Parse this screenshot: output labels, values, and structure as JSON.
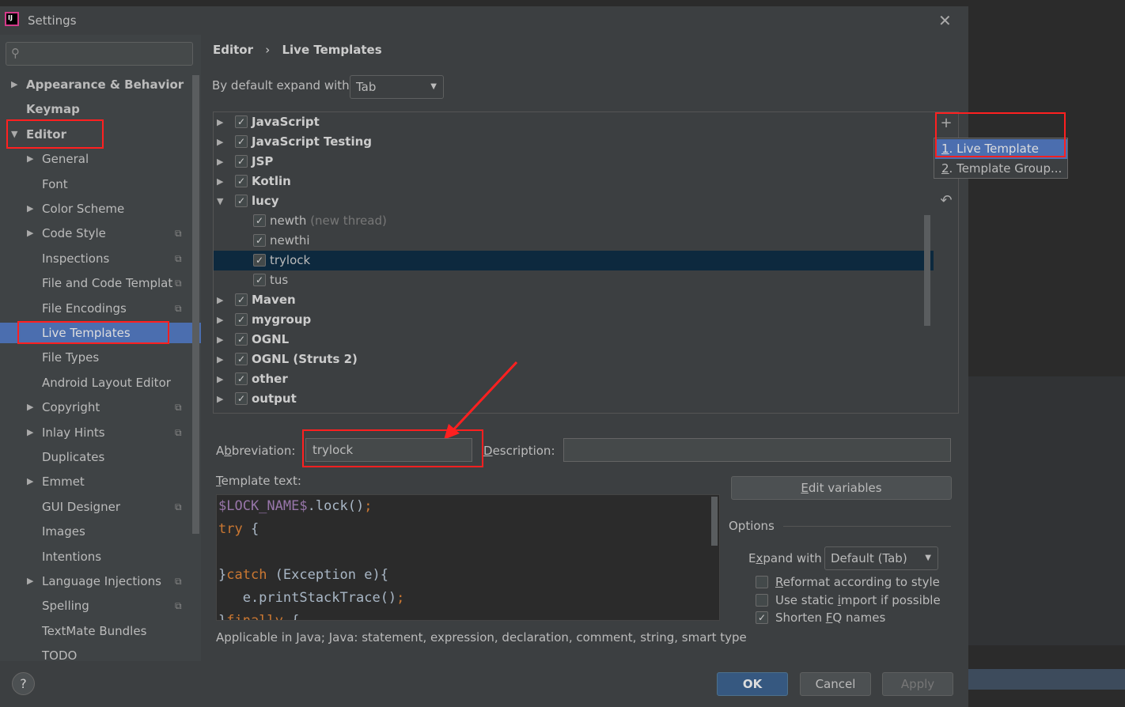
{
  "window": {
    "title": "Settings",
    "close": "✕",
    "app_icon": "IJ"
  },
  "search": {
    "placeholder": "",
    "icon": "search-icon"
  },
  "sidebar": {
    "items": [
      {
        "label": "Appearance & Behavior",
        "arrow": "▶",
        "bold": true
      },
      {
        "label": "Keymap",
        "bold": true
      },
      {
        "label": "Editor",
        "arrow": "▼",
        "bold": true
      },
      {
        "label": "General",
        "arrow": "▶"
      },
      {
        "label": "Font"
      },
      {
        "label": "Color Scheme",
        "arrow": "▶"
      },
      {
        "label": "Code Style",
        "arrow": "▶",
        "copy": true
      },
      {
        "label": "Inspections",
        "copy": true
      },
      {
        "label": "File and Code Templat",
        "copy": true
      },
      {
        "label": "File Encodings",
        "copy": true
      },
      {
        "label": "Live Templates",
        "selected": true
      },
      {
        "label": "File Types"
      },
      {
        "label": "Android Layout Editor"
      },
      {
        "label": "Copyright",
        "arrow": "▶",
        "copy": true
      },
      {
        "label": "Inlay Hints",
        "arrow": "▶",
        "copy": true
      },
      {
        "label": "Duplicates"
      },
      {
        "label": "Emmet",
        "arrow": "▶"
      },
      {
        "label": "GUI Designer",
        "copy": true
      },
      {
        "label": "Images"
      },
      {
        "label": "Intentions"
      },
      {
        "label": "Language Injections",
        "arrow": "▶",
        "copy": true
      },
      {
        "label": "Spelling",
        "copy": true
      },
      {
        "label": "TextMate Bundles"
      },
      {
        "label": "TODO"
      }
    ]
  },
  "breadcrumb": {
    "parent": "Editor",
    "sep": "›",
    "current": "Live Templates"
  },
  "expand": {
    "label": "By default expand with",
    "value": "Tab"
  },
  "tree": {
    "rows": [
      {
        "label": "JavaScript",
        "group": true,
        "arrow": "▶"
      },
      {
        "label": "JavaScript Testing",
        "group": true,
        "arrow": "▶"
      },
      {
        "label": "JSP",
        "group": true,
        "arrow": "▶"
      },
      {
        "label": "Kotlin",
        "group": true,
        "arrow": "▶"
      },
      {
        "label": "lucy",
        "group": true,
        "arrow": "▼"
      },
      {
        "label": "newth",
        "desc": "(new thread)"
      },
      {
        "label": "newthi"
      },
      {
        "label": "trylock",
        "selected": true
      },
      {
        "label": "tus"
      },
      {
        "label": "Maven",
        "group": true,
        "arrow": "▶"
      },
      {
        "label": "mygroup",
        "group": true,
        "arrow": "▶"
      },
      {
        "label": "OGNL",
        "group": true,
        "arrow": "▶"
      },
      {
        "label": "OGNL (Struts 2)",
        "group": true,
        "arrow": "▶"
      },
      {
        "label": "other",
        "group": true,
        "arrow": "▶"
      },
      {
        "label": "output",
        "group": true,
        "arrow": "▶"
      }
    ]
  },
  "tools": {
    "add": "+",
    "remove": "−",
    "undo": "↶"
  },
  "popup": {
    "items": [
      {
        "num": "1",
        "label": ". Live Template"
      },
      {
        "num": "2",
        "label": ". Template Group..."
      }
    ]
  },
  "form": {
    "abbreviation_label_pre": "A",
    "abbreviation_label_u": "b",
    "abbreviation_label_post": "breviation:",
    "abbreviation": "trylock",
    "description_label_u": "D",
    "description_label_post": "escription:",
    "description": "",
    "template_label_u": "T",
    "template_label_post": "emplate text:",
    "edit_variables_u": "E",
    "edit_variables_post": "dit variables",
    "applicable": "Applicable in Java; Java: statement, expression, declaration, comment, string, smart type"
  },
  "code": [
    [
      {
        "t": "$LOCK_NAME$",
        "c": "v"
      },
      {
        "t": ".lock()"
      },
      {
        "t": ";",
        "c": "k"
      }
    ],
    [
      {
        "t": "try",
        "c": "k"
      },
      {
        "t": " {"
      }
    ],
    [
      {
        "t": ""
      }
    ],
    [
      {
        "t": "}"
      },
      {
        "t": "catch",
        "c": "k"
      },
      {
        "t": " (Exception e){"
      }
    ],
    [
      {
        "t": "   e.printStackTrace()"
      },
      {
        "t": ";",
        "c": "k"
      }
    ],
    [
      {
        "t": "}"
      },
      {
        "t": "finally",
        "c": "k"
      },
      {
        "t": " {"
      }
    ]
  ],
  "options": {
    "title": "Options",
    "expand_label_pre": "E",
    "expand_label_u": "x",
    "expand_label_post": "pand with",
    "expand_value": "Default (Tab)",
    "checks": [
      {
        "pre": "",
        "u": "R",
        "post": "eformat according to style",
        "checked": false
      },
      {
        "pre": "Use static ",
        "u": "i",
        "post": "mport if possible",
        "checked": false
      },
      {
        "pre": "Shorten ",
        "u": "F",
        "post": "Q names",
        "checked": true
      }
    ]
  },
  "buttons": {
    "ok": "OK",
    "cancel": "Cancel",
    "apply": "Apply",
    "help": "?"
  },
  "colors": {
    "accent": "#4b6eaf",
    "selection": "#0d293e",
    "highlight_box": "#ff2020",
    "arrow": "#ff2020"
  }
}
